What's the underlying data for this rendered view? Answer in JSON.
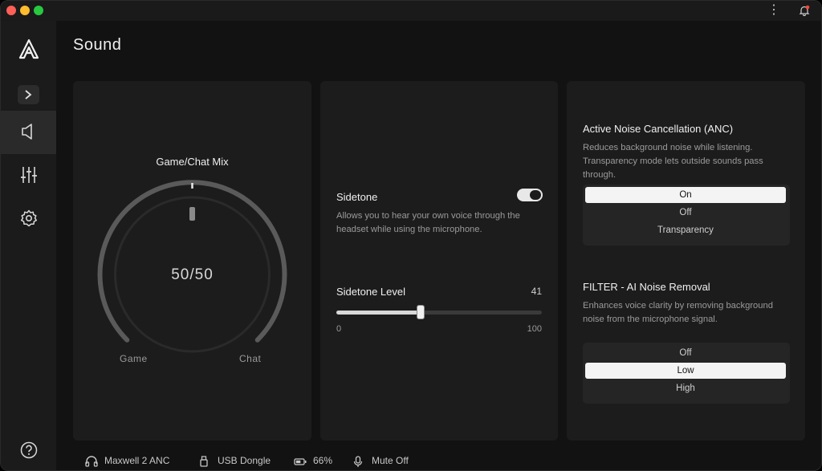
{
  "page_title": "Sound",
  "sidebar": {
    "items": [
      {
        "name": "sound",
        "icon": "speaker-icon",
        "active": true
      },
      {
        "name": "equalizer",
        "icon": "sliders-icon",
        "active": false
      },
      {
        "name": "settings",
        "icon": "gear-icon",
        "active": false
      }
    ]
  },
  "mix_card": {
    "title": "Game/Chat Mix",
    "value": "50/50",
    "left_label": "Game",
    "right_label": "Chat"
  },
  "sidetone_card": {
    "title": "Sidetone",
    "enabled": true,
    "description": "Allows you to hear your own voice through the headset while using the microphone.",
    "level_title": "Sidetone Level",
    "level_value": "41",
    "level_numeric": 41,
    "min_label": "0",
    "max_label": "100"
  },
  "anc": {
    "title": "Active Noise Cancellation (ANC)",
    "description": "Reduces background noise while listening. Transparency mode lets outside sounds pass through.",
    "options": [
      "On",
      "Off",
      "Transparency"
    ],
    "selected": "On"
  },
  "filter": {
    "title": "FILTER - AI Noise Removal",
    "description": "Enhances voice clarity by removing background noise from the microphone signal.",
    "options": [
      "Off",
      "Low",
      "High"
    ],
    "selected": "Low"
  },
  "status": {
    "device": "Maxwell 2 ANC",
    "connection": "USB Dongle",
    "battery": "66%",
    "mute": "Mute Off"
  },
  "colors": {
    "background": "#121212",
    "card": "#1c1c1c",
    "sidebar": "#1b1b1b",
    "accent": "#f4f4f4",
    "notification": "#ff453a"
  }
}
